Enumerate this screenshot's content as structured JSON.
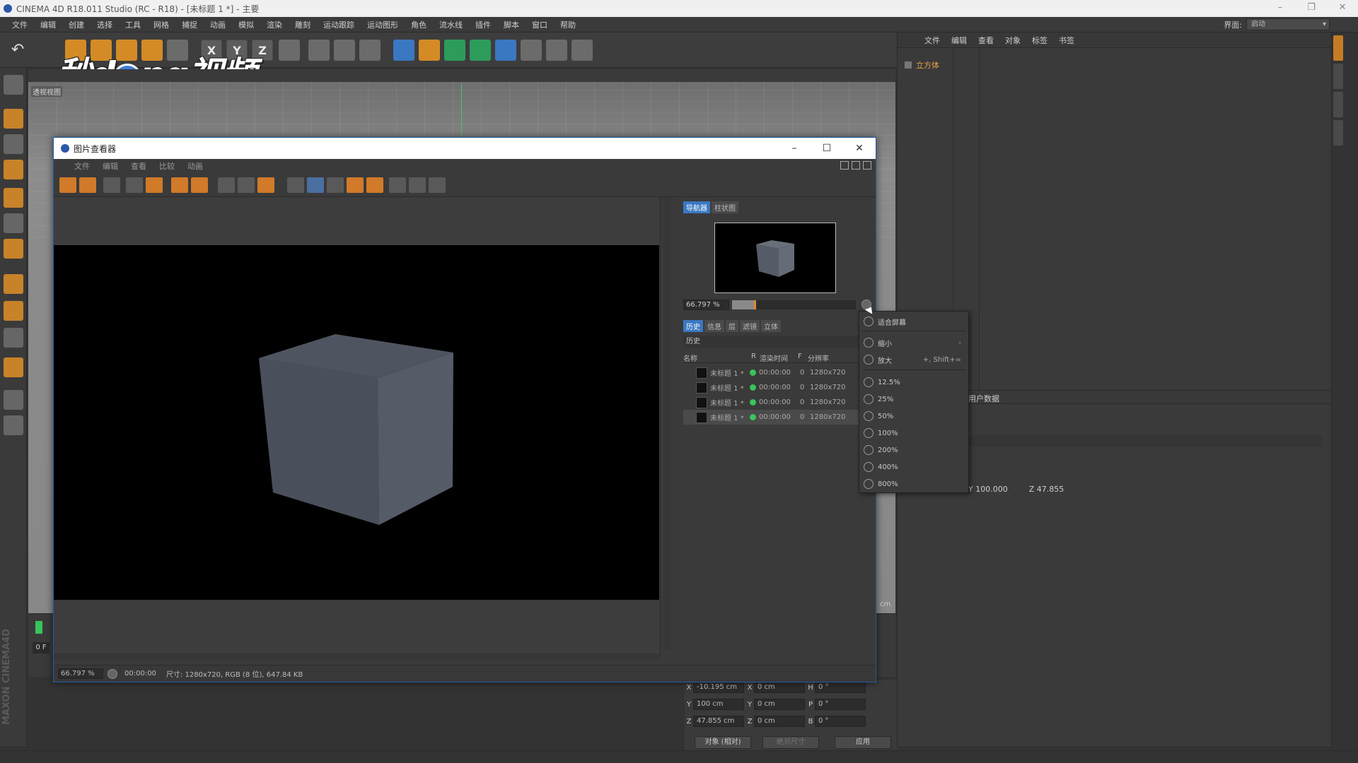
{
  "app": {
    "title": "CINEMA 4D R18.011 Studio (RC - R18) - [未标题 1 *] - 主要",
    "window_controls": [
      "–",
      "❐",
      "✕"
    ]
  },
  "menubar": {
    "items": [
      "文件",
      "编辑",
      "创建",
      "选择",
      "工具",
      "网格",
      "捕捉",
      "动画",
      "模拟",
      "渲染",
      "雕刻",
      "运动跟踪",
      "运动图形",
      "角色",
      "流水线",
      "插件",
      "脚本",
      "窗口",
      "帮助"
    ],
    "layout_label": "界面:",
    "layout_value": "启动"
  },
  "toolbar": {
    "axis_labels": [
      "X",
      "Y",
      "Z"
    ]
  },
  "watermark": {
    "text_a": "秒d",
    "text_b": "ng视频"
  },
  "viewport": {
    "label": "透视视图"
  },
  "object_manager": {
    "menu": [
      "文件",
      "编辑",
      "查看",
      "对象",
      "标签",
      "书签"
    ],
    "object_name": "立方体"
  },
  "attribute_manager": {
    "header": "用户数据",
    "coords": [
      "Y 100.000",
      "Z 47.855"
    ]
  },
  "coord_manager": {
    "rows": [
      {
        "axis": "X",
        "pos": "-10.195 cm",
        "axis2": "X",
        "size": "0 cm",
        "axis3": "H",
        "rot": "0 °"
      },
      {
        "axis": "Y",
        "pos": "100 cm",
        "axis2": "Y",
        "size": "0 cm",
        "axis3": "P",
        "rot": "0 °"
      },
      {
        "axis": "Z",
        "pos": "47.855 cm",
        "axis2": "Z",
        "size": "0 cm",
        "axis3": "B",
        "rot": "0 °"
      }
    ],
    "mode": "对象 (相对)",
    "size_mode": "绝对尺寸",
    "apply": "应用",
    "unit": "cm"
  },
  "timeline": {
    "frame": "0 F"
  },
  "picture_viewer": {
    "title": "图片查看器",
    "menu": [
      "文件",
      "编辑",
      "查看",
      "比较",
      "动画"
    ],
    "nav_tabs": [
      "导航器",
      "柱状图"
    ],
    "zoom_value": "66.797 %",
    "zoom_fraction": 0.18,
    "hist_tabs": [
      "历史",
      "信息",
      "层",
      "滤镜",
      "立体"
    ],
    "hist_label": "历史",
    "hist_columns": [
      "名称",
      "R",
      "渲染时间",
      "F",
      "分辨率"
    ],
    "history": [
      {
        "name": "未标题 1 *",
        "time": "00:00:00",
        "frame": "0",
        "res": "1280x720"
      },
      {
        "name": "未标题 1 *",
        "time": "00:00:00",
        "frame": "0",
        "res": "1280x720"
      },
      {
        "name": "未标题 1 *",
        "time": "00:00:00",
        "frame": "0",
        "res": "1280x720"
      },
      {
        "name": "未标题 1 *",
        "time": "00:00:00",
        "frame": "0",
        "res": "1280x720"
      }
    ],
    "status": {
      "zoom": "66.797 %",
      "time": "00:00:00",
      "info": "尺寸: 1280x720, RGB (8 位), 647.84 KB"
    }
  },
  "context_menu": {
    "fit": "适合屏幕",
    "zoom_out": "缩小",
    "zoom_out_shortcut": "-",
    "zoom_in": "放大",
    "zoom_in_shortcut": "+, Shift+=",
    "presets": [
      "12.5%",
      "25%",
      "50%",
      "100%",
      "200%",
      "400%",
      "800%"
    ]
  }
}
